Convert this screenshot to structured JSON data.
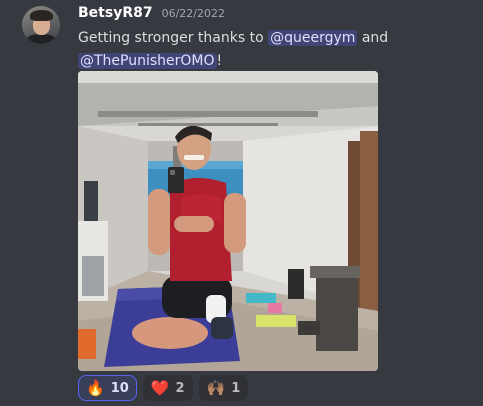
{
  "message": {
    "author": "BetsyR87",
    "timestamp": "06/22/2022",
    "text_before": "Getting stronger thanks to ",
    "mention_1": "@queergym",
    "text_between": " and",
    "mention_2": "@ThePunisherOMO",
    "text_after": "!"
  },
  "reactions": [
    {
      "emoji": "🔥",
      "icon": "fire-icon",
      "count": "10",
      "active": true
    },
    {
      "emoji": "❤️",
      "icon": "heart-icon",
      "count": "2",
      "active": false
    },
    {
      "emoji": "🙌🏽",
      "icon": "raised-hands-icon",
      "count": "1",
      "active": false
    }
  ],
  "colors": {
    "background": "#36393f",
    "mention_bg": "#414675",
    "mention_text": "#dee0fc",
    "active_reaction_border": "#5865f2"
  }
}
